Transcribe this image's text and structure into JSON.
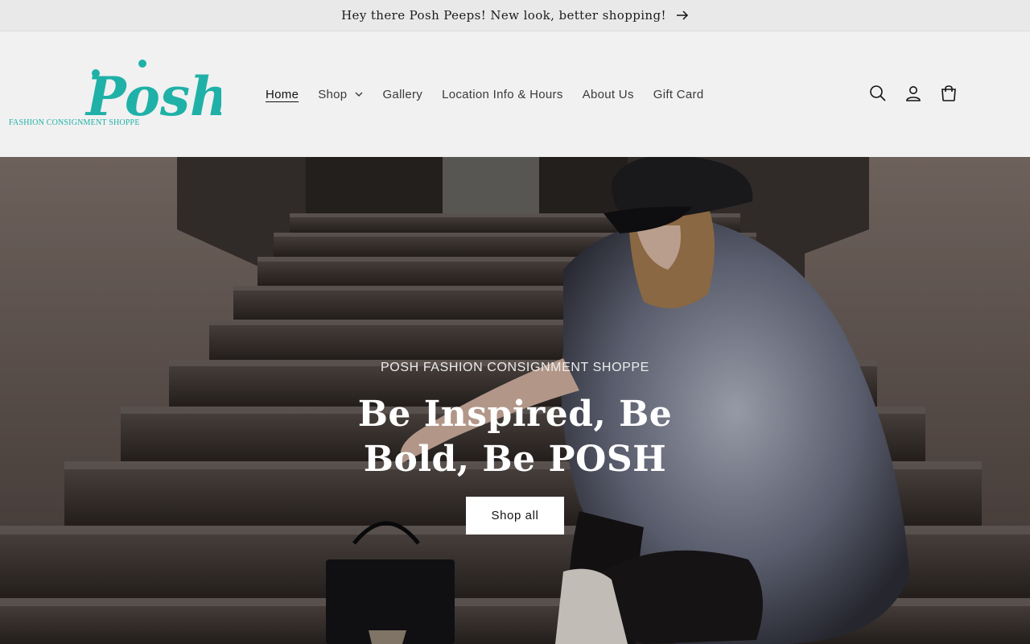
{
  "announcement": {
    "text": "Hey there Posh Peeps! New look, better shopping!",
    "arrow_icon": "arrow-right-icon"
  },
  "logo": {
    "mark": "Posh",
    "tagline": "FASHION CONSIGNMENT SHOPPE",
    "color": "#1fb1a8"
  },
  "nav": {
    "items": [
      {
        "label": "Home",
        "active": true
      },
      {
        "label": "Shop",
        "has_dropdown": true
      },
      {
        "label": "Gallery"
      },
      {
        "label": "Location Info & Hours"
      },
      {
        "label": "About Us"
      },
      {
        "label": "Gift Card"
      }
    ]
  },
  "header_icons": [
    "search-icon",
    "account-icon",
    "cart-icon"
  ],
  "hero": {
    "subheading": "POSH FASHION CONSIGNMENT SHOPPE",
    "heading": "Be Inspired, Be Bold, Be POSH",
    "button_label": "Shop all"
  }
}
